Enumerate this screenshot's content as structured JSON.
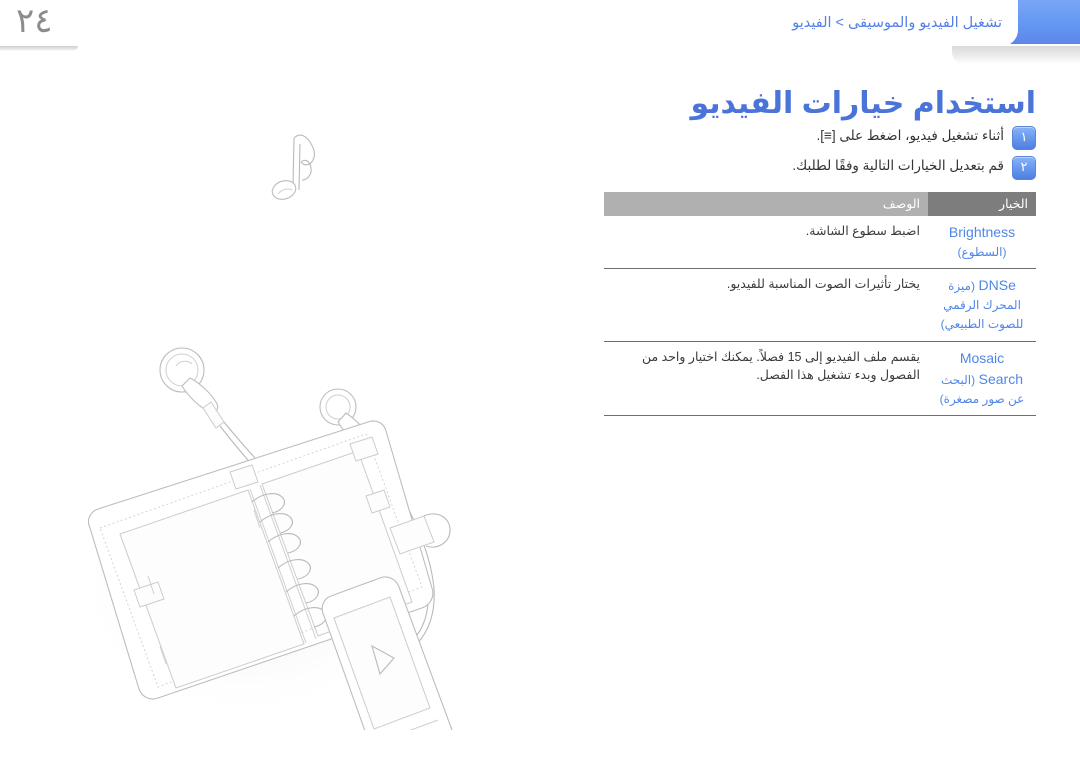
{
  "page": {
    "number": "٢٤",
    "language": "ar",
    "direction": "rtl"
  },
  "header": {
    "breadcrumb": "تشغيل الفيديو والموسيقى > الفيديو",
    "accent_color": "#6497f2",
    "breadcrumb_color": "#5580e8",
    "bar_gradient_from": "#79a7f7",
    "bar_gradient_to": "#5d86ea"
  },
  "title": {
    "text": "استخدام خيارات الفيديو",
    "color": "#4a74d8"
  },
  "steps": [
    {
      "number": "١",
      "text": "أثناء تشغيل فيديو، اضغط على [≡].",
      "badge_color": "#6b9bf0"
    },
    {
      "number": "٢",
      "text": "قم بتعديل الخيارات التالية وفقًا لطلبك.",
      "badge_color": "#6b9bf0"
    }
  ],
  "options_table": {
    "headers": {
      "option": "الخيار",
      "description": "الوصف"
    },
    "header_colors": {
      "option_bg": "#7d7d7d",
      "description_bg": "#b0b0b0"
    },
    "option_text_color": "#4f86e8",
    "rows": [
      {
        "option_en": "Brightness",
        "option_ar": "(السطوع)",
        "description": "اضبط سطوع الشاشة."
      },
      {
        "option_en": "DNSe",
        "option_ar": "(ميزة المحرك الرقمي للصوت الطبيعي)",
        "description": "يختار تأثيرات الصوت المناسبة للفيديو."
      },
      {
        "option_en": "Mosaic Search",
        "option_ar": "(البحث عن صور مصغرة)",
        "description": "يقسم ملف الفيديو إلى 15 فصلاً. يمكنك اختيار واحد من الفصول وبدء تشغيل هذا الفصل."
      }
    ]
  },
  "illustration": {
    "caption": "رسم توضيحي: سماعات أذن ومشغل وسائط على منظم دفتر",
    "elements": [
      "music-note",
      "earphones",
      "organizer-notebook",
      "media-player",
      "play-icon"
    ],
    "line_color": "#bdbdbd"
  }
}
